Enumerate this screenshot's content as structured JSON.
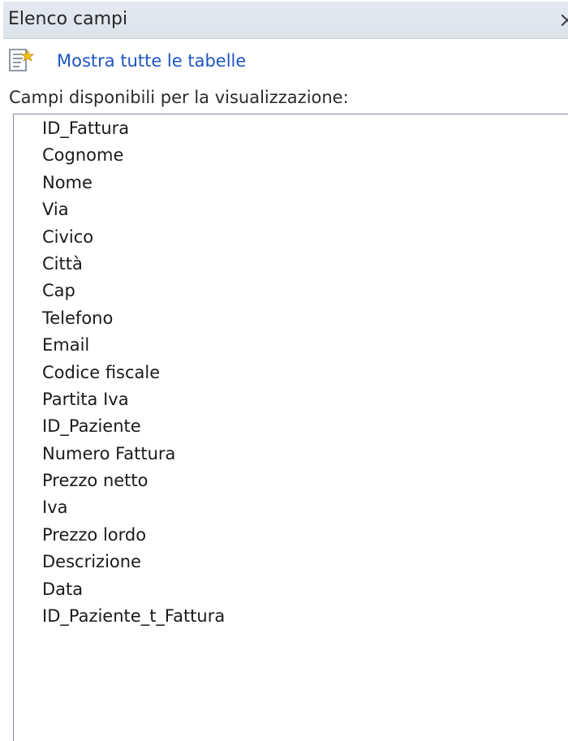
{
  "panel": {
    "title": "Elenco campi",
    "close_glyph": "×",
    "close_icon": "close-icon"
  },
  "show_tables": {
    "label": "Mostra tutte le tabelle",
    "icon": "tables-icon"
  },
  "available_fields": {
    "label": "Campi disponibili per la visualizzazione:",
    "items": [
      "ID_Fattura",
      "Cognome",
      "Nome",
      "Via",
      "Civico",
      "Città",
      "Cap",
      "Telefono",
      "Email",
      "Codice fiscale",
      "Partita Iva",
      "ID_Paziente",
      "Numero Fattura",
      "Prezzo netto",
      "Iva",
      "Prezzo lordo",
      "Descrizione",
      "Data",
      "ID_Paziente_t_Fattura"
    ]
  },
  "colors": {
    "link": "#1f55c4",
    "title_bar": "#e1e6ee",
    "list_border": "#7f8c9c"
  }
}
